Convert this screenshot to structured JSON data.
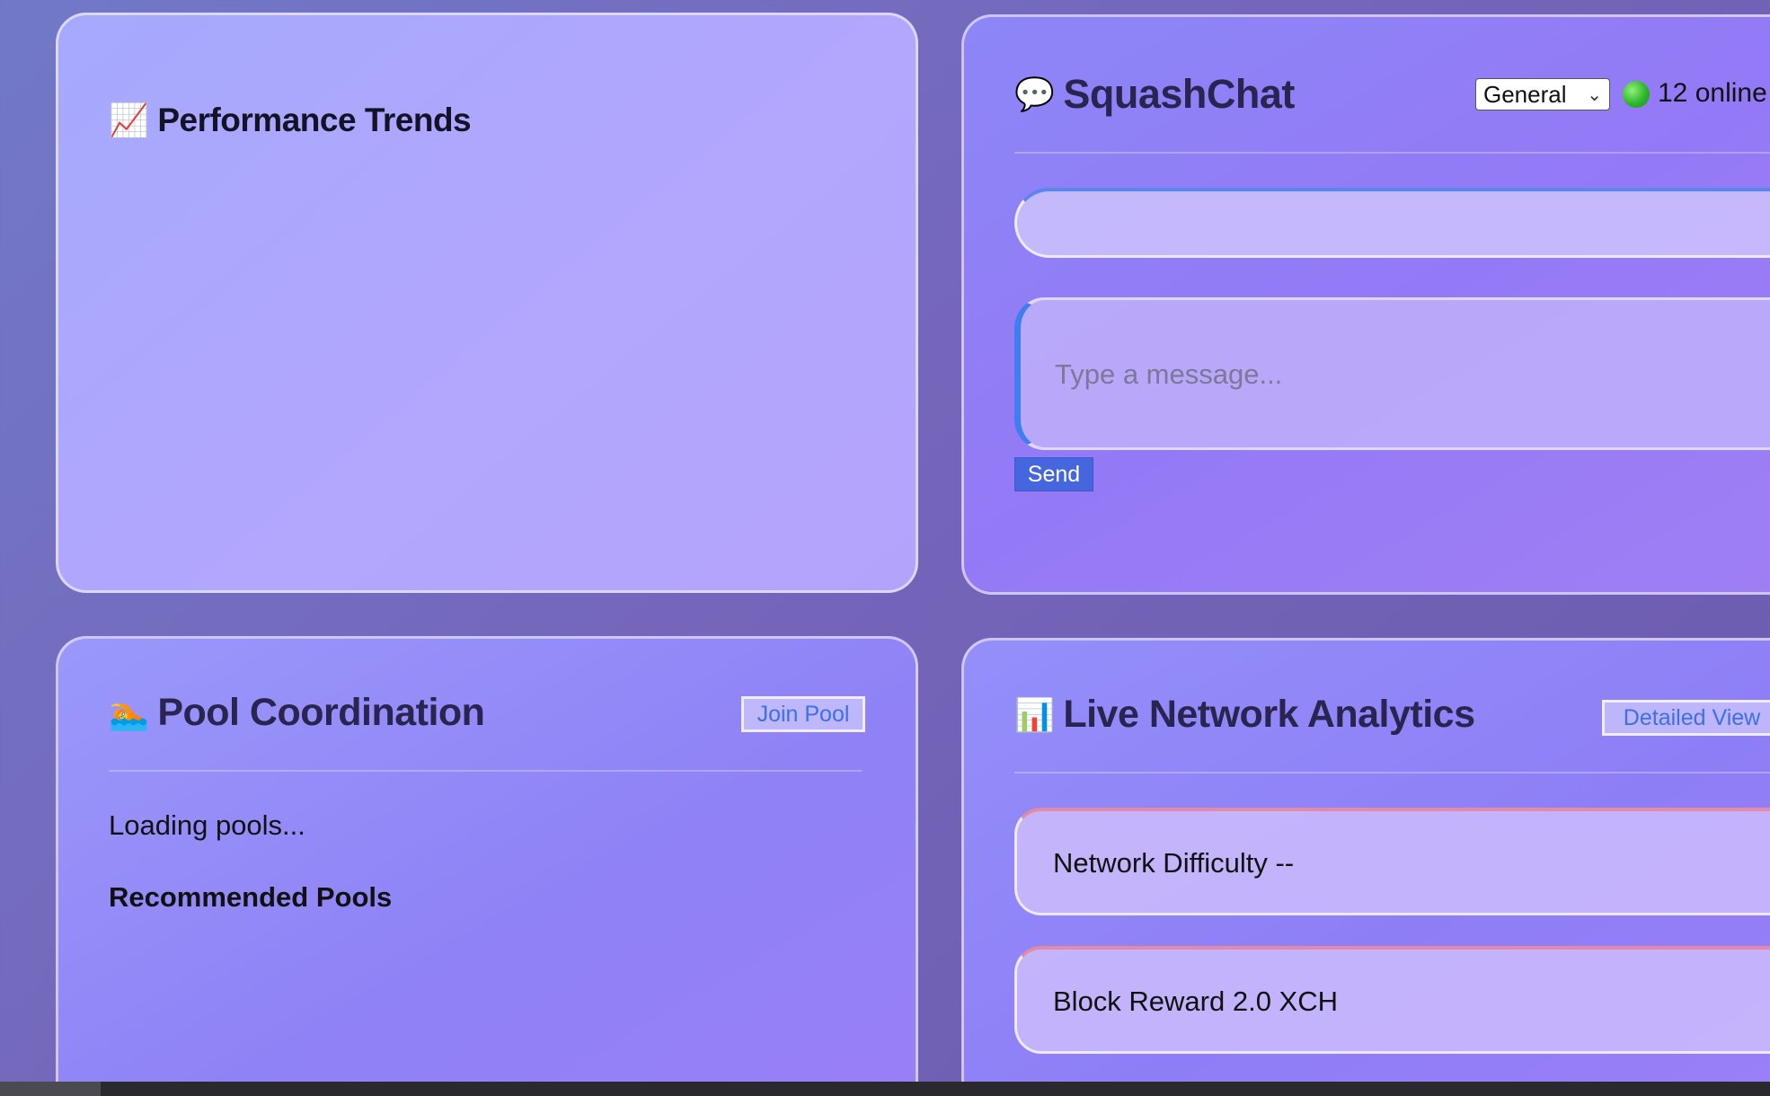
{
  "performance": {
    "emoji": "📈",
    "title": "Performance Trends"
  },
  "chat": {
    "emoji": "💬",
    "title": "SquashChat",
    "channel_selected": "General",
    "online_text": "12 online",
    "input_placeholder": "Type a message...",
    "send_label": "Send"
  },
  "pool": {
    "emoji": "🏊",
    "title": "Pool Coordination",
    "join_label": "Join Pool",
    "loading_text": "Loading pools...",
    "recommended_heading": "Recommended Pools"
  },
  "network": {
    "emoji": "📊",
    "title": "Live Network Analytics",
    "detail_label": "Detailed View",
    "stats": [
      {
        "text": "Network Difficulty --"
      },
      {
        "text": "Block Reward 2.0 XCH"
      }
    ]
  },
  "colors": {
    "accent_blue": "#4666de",
    "online_green": "#2fb52c",
    "stat_border_pink": "#e58aa6"
  }
}
